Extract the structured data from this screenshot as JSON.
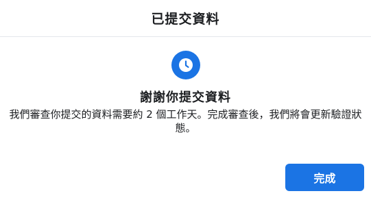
{
  "header": {
    "title": "已提交資料"
  },
  "main": {
    "icon": "clock-icon",
    "heading": "謝謝你提交資料",
    "message": "我們審查你提交的資料需要約 2 個工作天。完成審查後，我們將會更新驗證狀態。"
  },
  "footer": {
    "done_label": "完成"
  },
  "colors": {
    "accent": "#1b74e4",
    "text": "#1c1e21",
    "divider": "#e4e6eb"
  }
}
